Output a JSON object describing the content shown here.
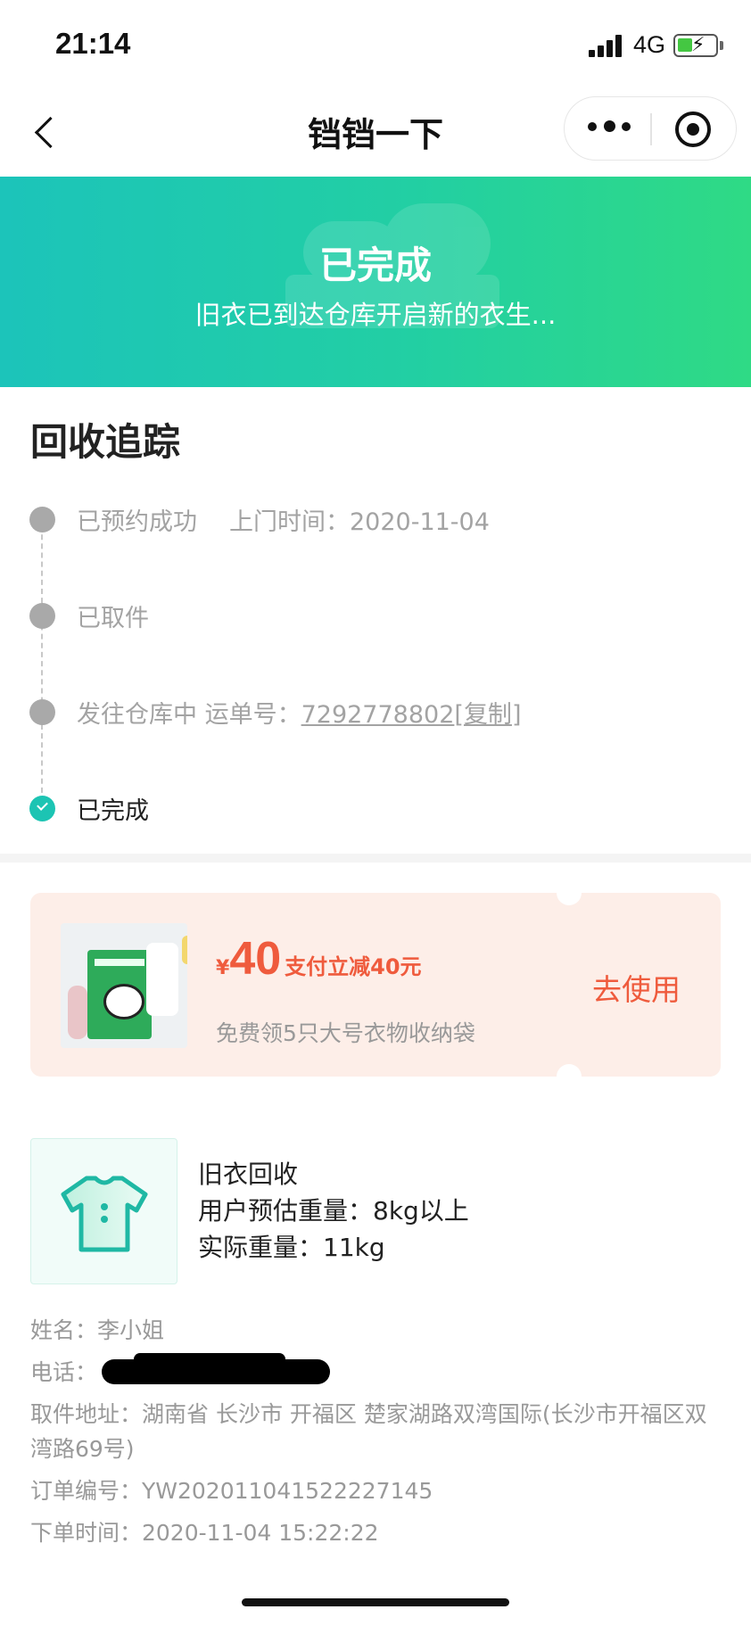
{
  "status_bar": {
    "time": "21:14",
    "network": "4G"
  },
  "nav": {
    "title": "铛铛一下"
  },
  "banner": {
    "title": "已完成",
    "subtitle": "旧衣已到达仓库开启新的衣生..."
  },
  "tracking": {
    "title": "回收追踪",
    "steps": [
      {
        "label": "已预约成功",
        "extra": "上门时间：2020-11-04"
      },
      {
        "label": "已取件"
      },
      {
        "label": "发往仓库中",
        "waybill_label": "运单号：",
        "waybill_number": "7292778802",
        "copy_label": "复制"
      },
      {
        "label": "已完成"
      }
    ]
  },
  "coupon": {
    "currency": "¥",
    "amount": "40",
    "desc": "支付立减40元",
    "subtitle": "免费领5只大号衣物收纳袋",
    "action": "去使用"
  },
  "product": {
    "name": "旧衣回收",
    "estimate": "用户预估重量：8kg以上",
    "actual": "实际重量：11kg"
  },
  "details": {
    "name": "姓名：李小姐",
    "phone_label": "电话：",
    "address": "取件地址：湖南省 长沙市 开福区 楚家湖路双湾国际(长沙市开福区双湾路69号)",
    "order_no": "订单编号：YW202011041522227145",
    "order_time": "下单时间：2020-11-04 15:22:22"
  },
  "colors": {
    "banner_start": "#1cc4ba",
    "banner_end": "#2fda85",
    "accent": "#ef5b3d",
    "done_dot": "#1cc4b3"
  }
}
